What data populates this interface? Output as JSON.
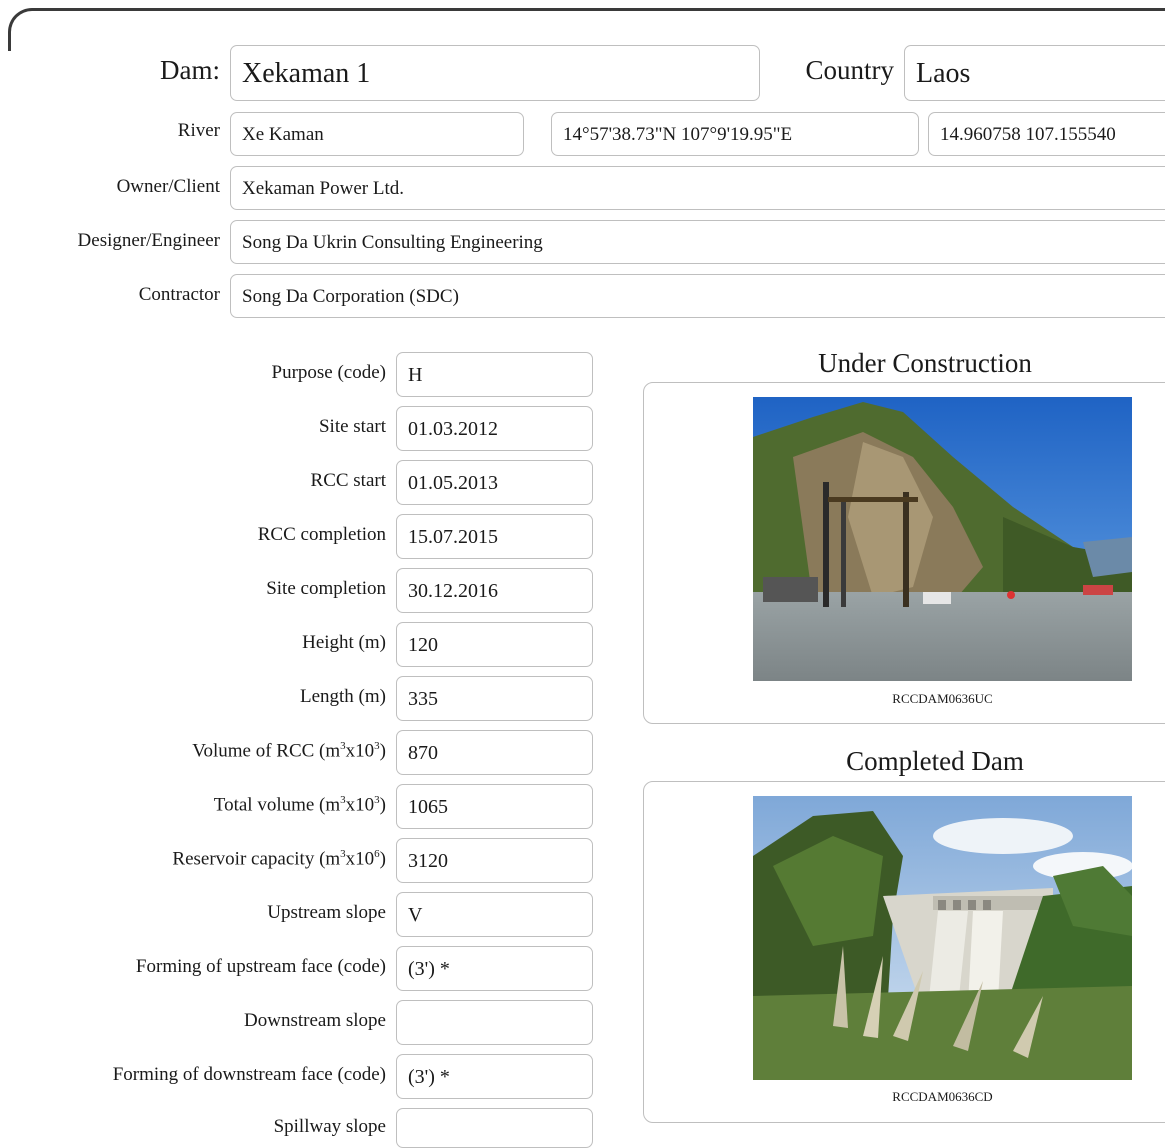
{
  "dam": {
    "label": "Dam:",
    "value": "Xekaman 1"
  },
  "country": {
    "label": "Country",
    "value": "Laos"
  },
  "river": {
    "label": "River",
    "value": "Xe Kaman",
    "coords_dms": "14°57'38.73\"N 107°9'19.95\"E",
    "coords_decimal": "14.960758 107.155540"
  },
  "owner": {
    "label": "Owner/Client",
    "value": "Xekaman Power Ltd."
  },
  "designer": {
    "label": "Designer/Engineer",
    "value": "Song Da Ukrin Consulting Engineering"
  },
  "contractor": {
    "label": "Contractor",
    "value": "Song Da Corporation (SDC)"
  },
  "fields": [
    {
      "label": "Purpose (code)",
      "value": "H"
    },
    {
      "label": "Site start",
      "value": "01.03.2012"
    },
    {
      "label": "RCC start",
      "value": "01.05.2013"
    },
    {
      "label": "RCC completion",
      "value": "15.07.2015"
    },
    {
      "label": "Site completion",
      "value": "30.12.2016"
    },
    {
      "label": "Height (m)",
      "value": "120"
    },
    {
      "label": "Length (m)",
      "value": "335"
    },
    {
      "label_pre": "Volume of RCC (m",
      "label_sup1": "3",
      "label_mid": "x10",
      "label_sup2": "3",
      "label_post": ")",
      "value": "870"
    },
    {
      "label_pre": "Total volume (m",
      "label_sup1": "3",
      "label_mid": "x10",
      "label_sup2": "3",
      "label_post": ")",
      "value": "1065"
    },
    {
      "label_pre": "Reservoir capacity (m",
      "label_sup1": "3",
      "label_mid": "x10",
      "label_sup2": "6",
      "label_post": ")",
      "value": "3120"
    },
    {
      "label": "Upstream slope",
      "value": "V"
    },
    {
      "label": "Forming of upstream face (code)",
      "value": "(3') *"
    },
    {
      "label": "Downstream slope",
      "value": ""
    },
    {
      "label": "Forming of downstream face (code)",
      "value": "(3') *"
    },
    {
      "label": "Spillway slope",
      "value": ""
    }
  ],
  "photos": {
    "under_construction": {
      "title": "Under Construction",
      "caption": "RCCDAM0636UC"
    },
    "completed": {
      "title": "Completed Dam",
      "caption": "RCCDAM0636CD"
    }
  }
}
